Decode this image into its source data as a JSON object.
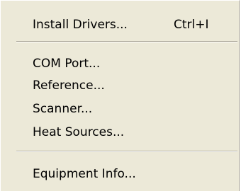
{
  "menu": {
    "items": [
      {
        "label": "Install Drivers...",
        "shortcut": "Ctrl+I"
      },
      {
        "label": "COM Port..."
      },
      {
        "label": "Reference..."
      },
      {
        "label": "Scanner..."
      },
      {
        "label": "Heat Sources..."
      },
      {
        "label": "Equipment Info..."
      }
    ]
  }
}
